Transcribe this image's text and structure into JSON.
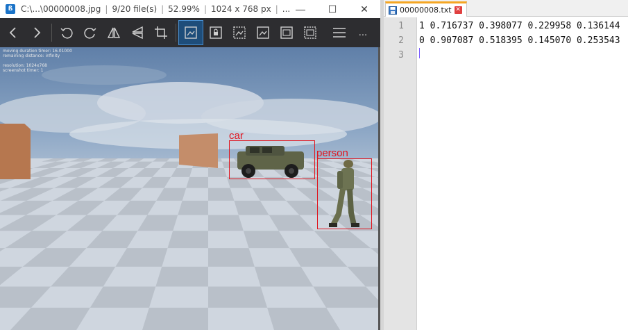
{
  "viewer": {
    "app_icon_letter": "ß",
    "title": {
      "file": "C:\\...\\00000008.jpg",
      "count": "9/20 file(s)",
      "zoom": "52.99%",
      "dims": "1024 x 768 px",
      "more": "..."
    },
    "window_controls": [
      "—",
      "☐",
      "✕"
    ],
    "toolbar": [
      {
        "name": "prev-icon"
      },
      {
        "name": "next-icon"
      },
      {
        "name": "rotate-left-icon"
      },
      {
        "name": "rotate-right-icon"
      },
      {
        "name": "flip-horizontal-icon"
      },
      {
        "name": "flip-vertical-icon"
      },
      {
        "name": "crop-icon"
      },
      {
        "name": "fit-image-icon"
      },
      {
        "name": "lock-icon"
      },
      {
        "name": "image-a-icon"
      },
      {
        "name": "image-b-icon"
      },
      {
        "name": "image-c-icon"
      },
      {
        "name": "image-d-icon"
      },
      {
        "name": "menu-icon"
      },
      {
        "name": "more-icon"
      }
    ],
    "more_label": "...",
    "osd": [
      "moving duration timer: 16.01000",
      "remaining distance: infinity",
      "",
      "resolution: 1024x768",
      "screenshot timer: 1"
    ],
    "boxes": [
      {
        "label": "car"
      },
      {
        "label": "person"
      }
    ],
    "accent_color": "#e0141e"
  },
  "editor": {
    "tab_name": "00000008.txt",
    "tab_close": "✕",
    "lines": [
      {
        "num": "1",
        "text": "1 0.716737 0.398077 0.229958 0.136144"
      },
      {
        "num": "2",
        "text": "0 0.907087 0.518395 0.145070 0.253543"
      },
      {
        "num": "3",
        "text": ""
      }
    ]
  }
}
